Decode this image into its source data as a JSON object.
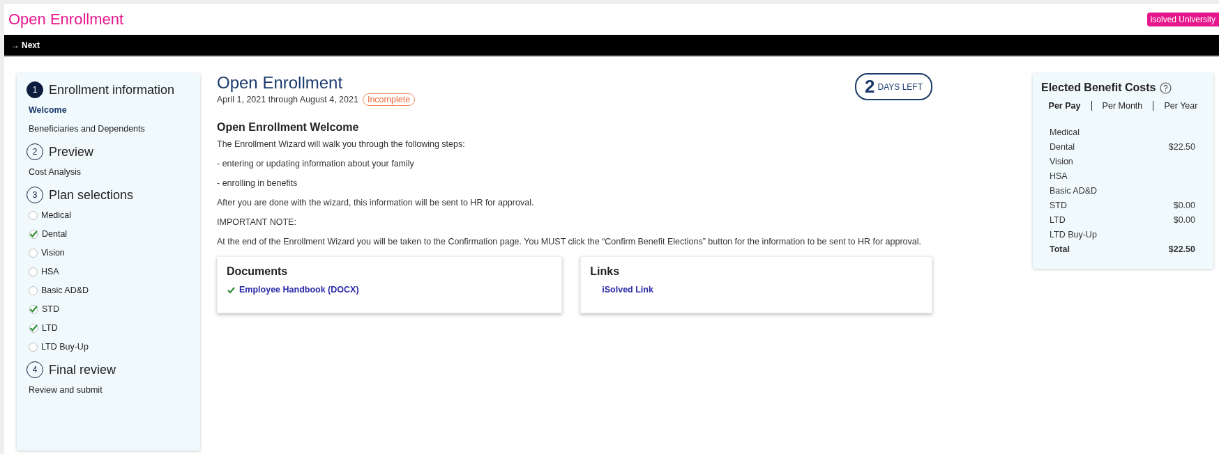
{
  "header": {
    "title": "Open Enrollment",
    "badge": "isolved University"
  },
  "toolbar": {
    "next_icon": "→",
    "next": "Next"
  },
  "steps": [
    {
      "number": "1",
      "title": "Enrollment information",
      "current": true,
      "items": [
        {
          "label": "Welcome",
          "selected": true
        },
        {
          "label": "Beneficiaries and Dependents",
          "selected": false
        }
      ]
    },
    {
      "number": "2",
      "title": "Preview",
      "current": false,
      "items": [
        {
          "label": "Cost Analysis",
          "selected": false
        }
      ]
    },
    {
      "number": "3",
      "title": "Plan selections",
      "current": false,
      "items": [
        {
          "label": "Medical",
          "selected": false,
          "checked": false
        },
        {
          "label": "Dental",
          "selected": false,
          "checked": true
        },
        {
          "label": "Vision",
          "selected": false,
          "checked": false
        },
        {
          "label": "HSA",
          "selected": false,
          "checked": false
        },
        {
          "label": "Basic AD&D",
          "selected": false,
          "checked": false
        },
        {
          "label": "STD",
          "selected": false,
          "checked": true
        },
        {
          "label": "LTD",
          "selected": false,
          "checked": true
        },
        {
          "label": "LTD Buy-Up",
          "selected": false,
          "checked": false
        }
      ]
    },
    {
      "number": "4",
      "title": "Final review",
      "current": false,
      "items": [
        {
          "label": "Review and submit",
          "selected": false
        }
      ]
    }
  ],
  "main": {
    "title": "Open Enrollment",
    "dates": "April 1, 2021 through August 4, 2021",
    "status": "Incomplete",
    "days_number": "2",
    "days_label": "DAYS LEFT",
    "heading": "Open Enrollment Welcome",
    "paragraphs": [
      "The Enrollment Wizard will walk you through the following steps:",
      "- entering or updating information about your family",
      "- enrolling in benefits",
      "After you are done with the wizard, this information will be sent to HR for approval.",
      "IMPORTANT NOTE:",
      "At the end of the Enrollment Wizard you will be taken to the Confirmation page. You MUST click the “Confirm Benefit Elections” button for the information to be sent to HR for approval."
    ],
    "documents": {
      "title": "Documents",
      "items": [
        {
          "label": "Employee Handbook (DOCX)",
          "checked": true
        }
      ]
    },
    "links": {
      "title": "Links",
      "items": [
        {
          "label": "iSolved Link",
          "checked": false
        }
      ]
    }
  },
  "costs": {
    "title": "Elected Benefit Costs",
    "tabs": [
      {
        "label": "Per Pay",
        "selected": true
      },
      {
        "label": "Per Month",
        "selected": false
      },
      {
        "label": "Per Year",
        "selected": false
      }
    ],
    "rows": [
      {
        "name": "Medical"
      },
      {
        "name": "Dental",
        "amount": "$22.50"
      },
      {
        "name": "Vision"
      },
      {
        "name": "HSA"
      },
      {
        "name": "Basic AD&D"
      },
      {
        "name": "STD",
        "amount": "$0.00"
      },
      {
        "name": "LTD",
        "amount": "$0.00"
      },
      {
        "name": "LTD Buy-Up"
      }
    ],
    "total": {
      "name": "Total",
      "amount": "$22.50"
    }
  }
}
